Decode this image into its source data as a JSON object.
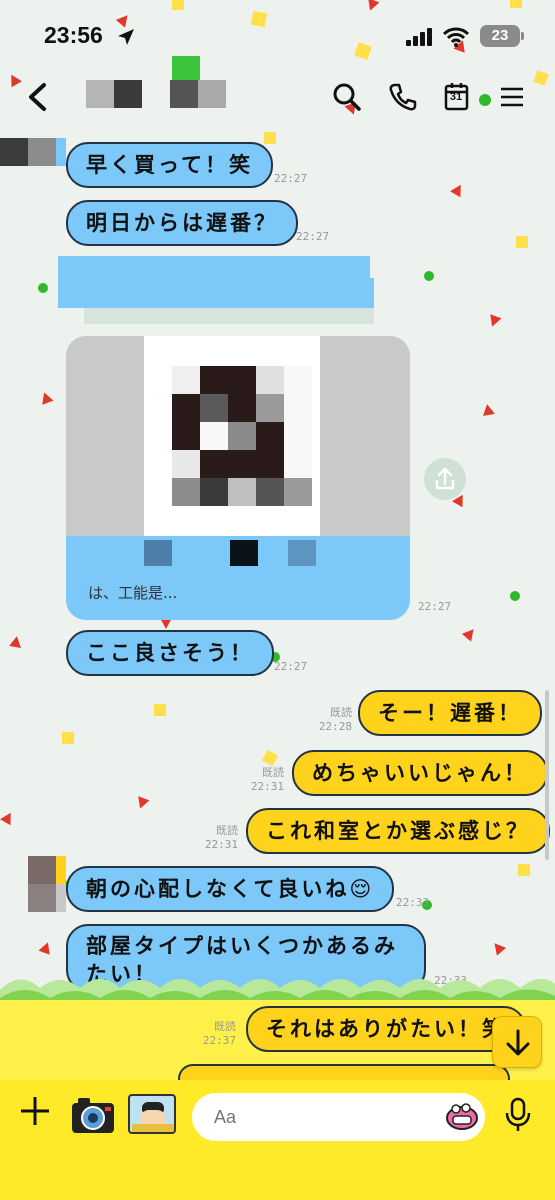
{
  "status_bar": {
    "time": "23:56",
    "battery": "23"
  },
  "header": {
    "calendar_day": "31"
  },
  "messages": [
    {
      "id": "m1",
      "sender": "other",
      "text": "早く買って！笑",
      "time": "22:27"
    },
    {
      "id": "m2",
      "sender": "other",
      "text": "明日からは遅番？",
      "time": "22:27"
    },
    {
      "id": "m3",
      "sender": "other",
      "type": "image",
      "caption": "は、工能是...",
      "time": "22:27"
    },
    {
      "id": "m4",
      "sender": "other",
      "text": "ここ良さそう！",
      "time": "22:27"
    },
    {
      "id": "m5",
      "sender": "me",
      "text": "そー！遅番！",
      "read": "既読",
      "time": "22:28"
    },
    {
      "id": "m6",
      "sender": "me",
      "text": "めちゃいいじゃん！",
      "read": "既読",
      "time": "22:31"
    },
    {
      "id": "m7",
      "sender": "me",
      "text": "これ和室とか選ぶ感じ？",
      "read": "既読",
      "time": "22:31"
    },
    {
      "id": "m8",
      "sender": "other",
      "text": "朝の心配しなくて良いね😌",
      "time": "22:33"
    },
    {
      "id": "m9",
      "sender": "other",
      "text": "部屋タイプはいくつかあるみたい！",
      "time": "22:33"
    },
    {
      "id": "m10",
      "sender": "me",
      "text": "それはありがたい！笑",
      "read": "既読",
      "time": "22:37"
    }
  ],
  "composer": {
    "placeholder": "Aa"
  },
  "colors": {
    "bubble_other": "#7cc8f8",
    "bubble_me": "#ffd21c",
    "footer_yellow": "#ffea2a",
    "background": "#eef2ee"
  },
  "icons": [
    "back-icon",
    "search-icon",
    "phone-icon",
    "calendar-icon",
    "menu-icon",
    "share-icon",
    "plus-icon",
    "camera-icon",
    "photo-icon",
    "emoji-icon",
    "mic-icon",
    "arrow-down-icon"
  ]
}
